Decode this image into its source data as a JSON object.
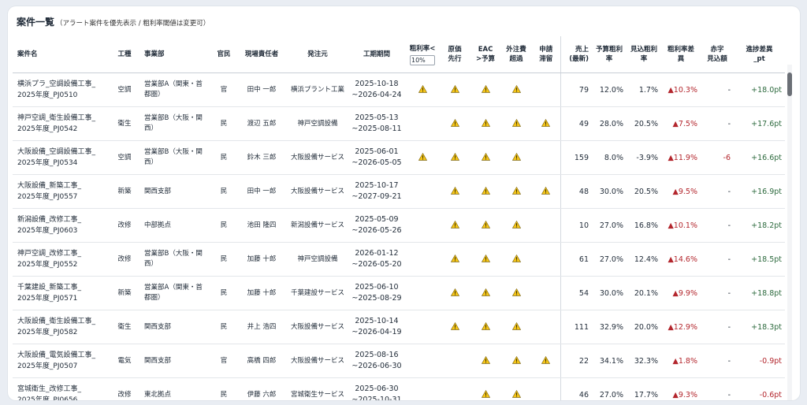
{
  "title": "案件一覧",
  "subtitle": "（アラート案件を優先表示 / 粗利率閾値は変更可）",
  "threshold_value": "10%",
  "columns": {
    "name": "案件名",
    "kind": "工種",
    "dept": "事業部",
    "sector": "官民",
    "manager": "現場責任者",
    "client": "発注元",
    "period": "工期期間",
    "margin_low_1": "粗利率<",
    "cost_first_1": "原価",
    "cost_first_2": "先行",
    "eac_1": "EAC",
    "eac_2": ">予算",
    "outsource_1": "外注費",
    "outsource_2": "超過",
    "app_1": "申請",
    "app_2": "滞留",
    "sales_1": "売上",
    "sales_2": "(最新)",
    "bmargin_1": "予算粗利",
    "bmargin_2": "率",
    "fmargin_1": "見込粗利",
    "fmargin_2": "率",
    "mdiff_1": "粗利率差",
    "mdiff_2": "異",
    "deficit_1": "赤字",
    "deficit_2": "見込額",
    "progress_1": "進捗差異",
    "progress_2": "_pt"
  },
  "rows": [
    {
      "name1": "横浜プラ_空調設備工事_",
      "name2": "2025年度_PJ0510",
      "kind": "空調",
      "dept": "営業部A（関東・首都圏）",
      "sector": "官",
      "manager": "田中 一郎",
      "client": "横浜プラント工業",
      "start": "2025-10-18",
      "end": "~2026-04-24",
      "a1": true,
      "a2": true,
      "a3": true,
      "a4": true,
      "a5": false,
      "sales": "79",
      "bm": "12.0%",
      "fm": "1.7%",
      "diff": "▲10.3%",
      "deficit": "-",
      "prog": "+18.0pt",
      "prog_neg": false,
      "def_neg": false
    },
    {
      "name1": "神戸空調_衛生設備工事_",
      "name2": "2025年度_PJ0542",
      "kind": "衛生",
      "dept": "営業部B（大阪・関西）",
      "sector": "民",
      "manager": "渡辺 五郎",
      "client": "神戸空調設備",
      "start": "2025-05-13",
      "end": "~2025-08-11",
      "a1": false,
      "a2": true,
      "a3": true,
      "a4": true,
      "a5": true,
      "sales": "49",
      "bm": "28.0%",
      "fm": "20.5%",
      "diff": "▲7.5%",
      "deficit": "-",
      "prog": "+17.6pt",
      "prog_neg": false,
      "def_neg": false
    },
    {
      "name1": "大阪設備_空調設備工事_",
      "name2": "2025年度_PJ0534",
      "kind": "空調",
      "dept": "営業部B（大阪・関西）",
      "sector": "民",
      "manager": "鈴木 三郎",
      "client": "大阪設備サービス",
      "start": "2025-06-01",
      "end": "~2026-05-05",
      "a1": true,
      "a2": true,
      "a3": true,
      "a4": true,
      "a5": false,
      "sales": "159",
      "bm": "8.0%",
      "fm": "-3.9%",
      "diff": "▲11.9%",
      "deficit": "-6",
      "prog": "+16.6pt",
      "prog_neg": false,
      "def_neg": true
    },
    {
      "name1": "大阪設備_新築工事_",
      "name2": "2025年度_PJ0557",
      "kind": "新築",
      "dept": "関西支部",
      "sector": "民",
      "manager": "田中 一郎",
      "client": "大阪設備サービス",
      "start": "2025-10-17",
      "end": "~2027-09-21",
      "a1": false,
      "a2": true,
      "a3": true,
      "a4": true,
      "a5": true,
      "sales": "48",
      "bm": "30.0%",
      "fm": "20.5%",
      "diff": "▲9.5%",
      "deficit": "-",
      "prog": "+16.9pt",
      "prog_neg": false,
      "def_neg": false
    },
    {
      "name1": "新潟設備_改修工事_",
      "name2": "2025年度_PJ0603",
      "kind": "改修",
      "dept": "中部拠点",
      "sector": "民",
      "manager": "池田 隆四",
      "client": "新潟設備サービス",
      "start": "2025-05-09",
      "end": "~2026-05-26",
      "a1": false,
      "a2": true,
      "a3": true,
      "a4": true,
      "a5": false,
      "sales": "10",
      "bm": "27.0%",
      "fm": "16.8%",
      "diff": "▲10.1%",
      "deficit": "-",
      "prog": "+18.2pt",
      "prog_neg": false,
      "def_neg": false
    },
    {
      "name1": "神戸空調_改修工事_",
      "name2": "2025年度_PJ0552",
      "kind": "改修",
      "dept": "営業部B（大阪・関西）",
      "sector": "民",
      "manager": "加藤 十郎",
      "client": "神戸空調設備",
      "start": "2026-01-12",
      "end": "~2026-05-20",
      "a1": false,
      "a2": true,
      "a3": true,
      "a4": true,
      "a5": false,
      "sales": "61",
      "bm": "27.0%",
      "fm": "12.4%",
      "diff": "▲14.6%",
      "deficit": "-",
      "prog": "+18.5pt",
      "prog_neg": false,
      "def_neg": false
    },
    {
      "name1": "千葉建設_新築工事_",
      "name2": "2025年度_PJ0571",
      "kind": "新築",
      "dept": "営業部A（関東・首都圏）",
      "sector": "民",
      "manager": "加藤 十郎",
      "client": "千葉建設サービス",
      "start": "2025-06-10",
      "end": "~2025-08-29",
      "a1": false,
      "a2": true,
      "a3": true,
      "a4": true,
      "a5": false,
      "sales": "54",
      "bm": "30.0%",
      "fm": "20.1%",
      "diff": "▲9.9%",
      "deficit": "-",
      "prog": "+18.8pt",
      "prog_neg": false,
      "def_neg": false
    },
    {
      "name1": "大阪設備_衛生設備工事_",
      "name2": "2025年度_PJ0582",
      "kind": "衛生",
      "dept": "関西支部",
      "sector": "民",
      "manager": "井上 浩四",
      "client": "大阪設備サービス",
      "start": "2025-10-14",
      "end": "~2026-04-19",
      "a1": false,
      "a2": true,
      "a3": true,
      "a4": true,
      "a5": false,
      "sales": "111",
      "bm": "32.9%",
      "fm": "20.0%",
      "diff": "▲12.9%",
      "deficit": "-",
      "prog": "+18.3pt",
      "prog_neg": false,
      "def_neg": false
    },
    {
      "name1": "大阪設備_電気設備工事_",
      "name2": "2025年度_PJ0507",
      "kind": "電気",
      "dept": "関西支部",
      "sector": "官",
      "manager": "高橋 四郎",
      "client": "大阪設備サービス",
      "start": "2025-08-16",
      "end": "~2026-06-30",
      "a1": false,
      "a2": false,
      "a3": true,
      "a4": true,
      "a5": true,
      "sales": "22",
      "bm": "34.1%",
      "fm": "32.3%",
      "diff": "▲1.8%",
      "deficit": "-",
      "prog": "-0.9pt",
      "prog_neg": true,
      "def_neg": false
    },
    {
      "name1": "宮城衛生_改修工事_",
      "name2": "2025年度_PJ0656",
      "kind": "改修",
      "dept": "東北拠点",
      "sector": "民",
      "manager": "伊藤 六郎",
      "client": "宮城衛生サービス",
      "start": "2025-06-30",
      "end": "~2025-10-31",
      "a1": false,
      "a2": false,
      "a3": true,
      "a4": true,
      "a5": false,
      "sales": "46",
      "bm": "27.0%",
      "fm": "17.7%",
      "diff": "▲9.3%",
      "deficit": "-",
      "prog": "-0.6pt",
      "prog_neg": true,
      "def_neg": false
    }
  ],
  "icons": {
    "alert": "warning-triangle-icon"
  },
  "colors": {
    "alert_fill": "#f5c518",
    "negative": "#b3262d",
    "positive": "#2e6b3f"
  }
}
